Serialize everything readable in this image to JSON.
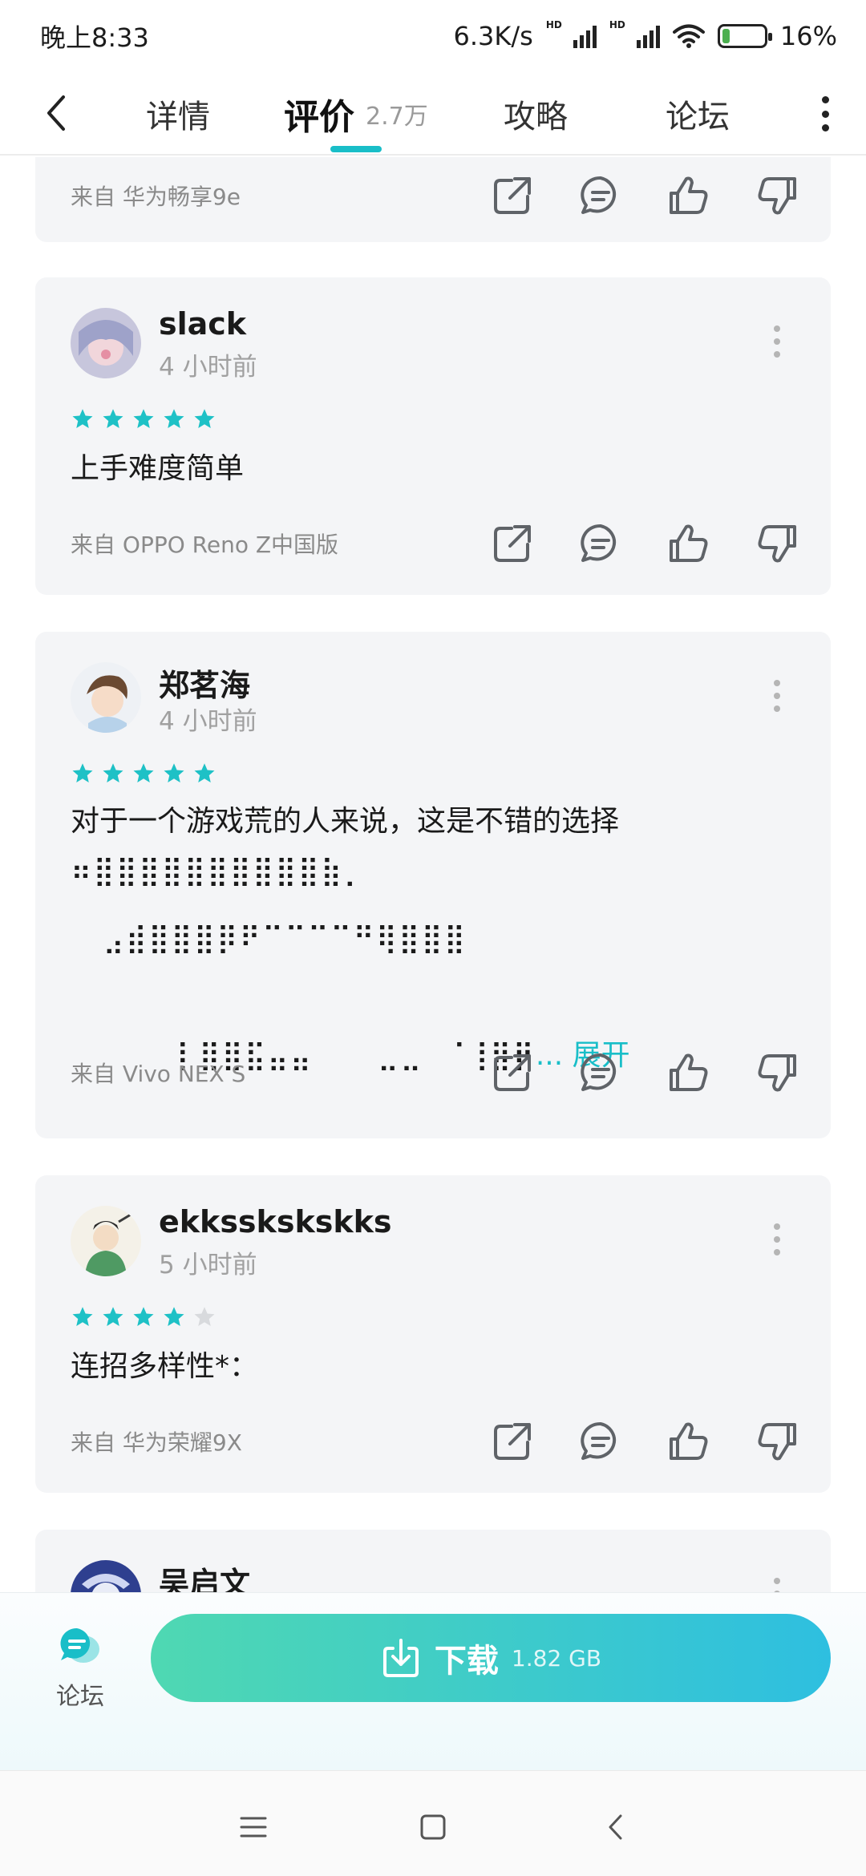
{
  "status_bar": {
    "time": "晚上8:33",
    "net_speed": "6.3K/s",
    "hd_label": "HD",
    "battery": "16%"
  },
  "tabs": {
    "details": "详情",
    "reviews": "评价",
    "reviews_count": "2.7万",
    "guide": "攻略",
    "forum": "论坛"
  },
  "reviews": [
    {
      "device": "来自 华为畅享9e"
    },
    {
      "username": "slack",
      "time": "4 小时前",
      "rating": 5,
      "content": "上手难度简单",
      "device": "来自 OPPO Reno Z中国版"
    },
    {
      "username": "郑茗海",
      "time": "4 小时前",
      "rating": 5,
      "content_line1": "对于一个游戏荒的人来说，这是不错的选择",
      "content_line2": "⠶⣿⣿⣿⣿⣿⣿⣿⣿⣿⣿⣷⡀",
      "content_line3": "   ⣠⣾⣿⣿⣿⡿⠟⠉⠉⠉⠉⠛⢿⣿⣿⣿",
      "content_line4": "   ⡇⣿⣿⣯⣤⣤      ⣀⣀  ⠈⢸⣿⡟",
      "expand": "... 展开",
      "device": "来自 Vivo NEX S"
    },
    {
      "username": "ekksskskskks",
      "time": "5 小时前",
      "rating": 4,
      "content": "连招多样性*：",
      "device": "来自 华为荣耀9X"
    },
    {
      "username": "吴启文"
    }
  ],
  "bottom": {
    "forum_label": "论坛",
    "download_label": "下载",
    "download_size": "1.82 GB"
  },
  "colors": {
    "accent": "#19bec8",
    "star_filled": "#1ec1c6",
    "star_empty": "#d8dadd",
    "card_bg": "#f4f5f7"
  }
}
